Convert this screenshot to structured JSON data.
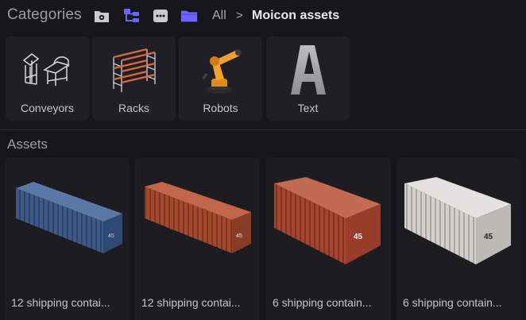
{
  "header": {
    "title": "Categories",
    "breadcrumb": {
      "root": "All",
      "separator": ">",
      "current": "Moicon assets"
    },
    "icons": [
      "folder-settings-icon",
      "tree-view-icon",
      "more-icon",
      "folder-icon"
    ]
  },
  "categories": [
    {
      "label": "Conveyors",
      "icon": "conveyor-thumbnail"
    },
    {
      "label": "Racks",
      "icon": "rack-thumbnail"
    },
    {
      "label": "Robots",
      "icon": "robot-arm-thumbnail"
    },
    {
      "label": "Text",
      "icon": "letter-a-thumbnail"
    }
  ],
  "assets_section": {
    "title": "Assets"
  },
  "assets": [
    {
      "label": "12 shipping contai...",
      "color": "#3d5a88",
      "door_number": "45"
    },
    {
      "label": "12 shipping contai...",
      "color": "#a34a2c",
      "door_number": "45"
    },
    {
      "label": "6 shipping contain...",
      "color": "#a64430",
      "door_number": "45"
    },
    {
      "label": "6 shipping contain...",
      "color": "#d3d1cc",
      "door_number": "45"
    }
  ],
  "colors": {
    "accent": "#6e63ff",
    "background": "#17171b",
    "card": "#1f1f25"
  }
}
